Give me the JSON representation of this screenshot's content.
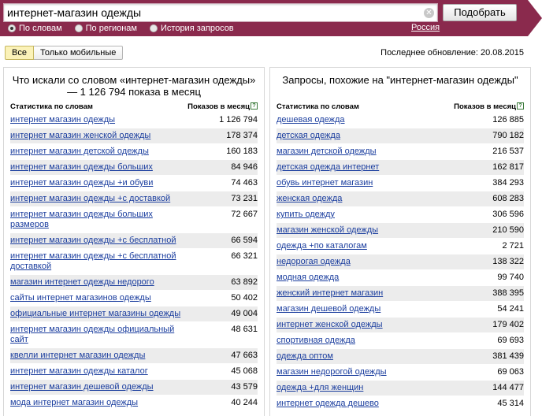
{
  "search": {
    "value": "интернет-магазин одежды",
    "button": "Подобрать"
  },
  "modes": [
    {
      "label": "По словам",
      "selected": true
    },
    {
      "label": "По регионам",
      "selected": false
    },
    {
      "label": "История запросов",
      "selected": false
    }
  ],
  "region": "Россия",
  "filters": [
    {
      "label": "Все",
      "active": true
    },
    {
      "label": "Только мобильные",
      "active": false
    }
  ],
  "updated": "Последнее обновление: 20.08.2015",
  "left": {
    "title": "Что искали со словом «интернет-магазин одежды» — 1 126 794 показа в месяц",
    "col_keywords": "Статистика по словам",
    "col_count": "Показов в месяц",
    "rows": [
      {
        "kw": "интернет магазин одежды",
        "n": "1 126 794"
      },
      {
        "kw": "интернет магазин женской одежды",
        "n": "178 374"
      },
      {
        "kw": "интернет магазин детской одежды",
        "n": "160 183"
      },
      {
        "kw": "интернет магазин одежды больших",
        "n": "84 946"
      },
      {
        "kw": "интернет магазин одежды +и обуви",
        "n": "74 463"
      },
      {
        "kw": "интернет магазин одежды +с доставкой",
        "n": "73 231"
      },
      {
        "kw": "интернет магазин одежды больших размеров",
        "n": "72 667"
      },
      {
        "kw": "интернет магазин одежды +с бесплатной",
        "n": "66 594"
      },
      {
        "kw": "интернет магазин одежды +с бесплатной доставкой",
        "n": "66 321"
      },
      {
        "kw": "магазин интернет одежды недорого",
        "n": "63 892"
      },
      {
        "kw": "сайты интернет магазинов одежды",
        "n": "50 402"
      },
      {
        "kw": "официальные интернет магазины одежды",
        "n": "49 004"
      },
      {
        "kw": "интернет магазин одежды официальный сайт",
        "n": "48 631"
      },
      {
        "kw": "квелли интернет магазин одежды",
        "n": "47 663"
      },
      {
        "kw": "интернет магазин одежды каталог",
        "n": "45 068"
      },
      {
        "kw": "интернет магазин дешевой одежды",
        "n": "43 579"
      },
      {
        "kw": "мода интернет магазин одежды",
        "n": "40 244"
      }
    ]
  },
  "right": {
    "title": "Запросы, похожие на \"интернет-магазин одежды\"",
    "col_keywords": "Статистика по словам",
    "col_count": "Показов в месяц",
    "rows": [
      {
        "kw": "дешевая одежда",
        "n": "126 885"
      },
      {
        "kw": "детская одежда",
        "n": "790 182"
      },
      {
        "kw": "магазин детской одежды",
        "n": "216 537"
      },
      {
        "kw": "детская одежда интернет",
        "n": "162 817"
      },
      {
        "kw": "обувь интернет магазин",
        "n": "384 293"
      },
      {
        "kw": "женская одежда",
        "n": "608 283"
      },
      {
        "kw": "купить одежду",
        "n": "306 596"
      },
      {
        "kw": "магазин женской одежды",
        "n": "210 590"
      },
      {
        "kw": "одежда +по каталогам",
        "n": "2 721"
      },
      {
        "kw": "недорогая одежда",
        "n": "138 322"
      },
      {
        "kw": "модная одежда",
        "n": "99 740"
      },
      {
        "kw": "женский интернет магазин",
        "n": "388 395"
      },
      {
        "kw": "магазин дешевой одежды",
        "n": "54 241"
      },
      {
        "kw": "интернет женской одежды",
        "n": "179 402"
      },
      {
        "kw": "спортивная одежда",
        "n": "69 693"
      },
      {
        "kw": "одежда оптом",
        "n": "381 439"
      },
      {
        "kw": "магазин недорогой одежды",
        "n": "69 063"
      },
      {
        "kw": "одежда +для женщин",
        "n": "144 477"
      },
      {
        "kw": "интернет одежда дешево",
        "n": "45 314"
      }
    ]
  }
}
